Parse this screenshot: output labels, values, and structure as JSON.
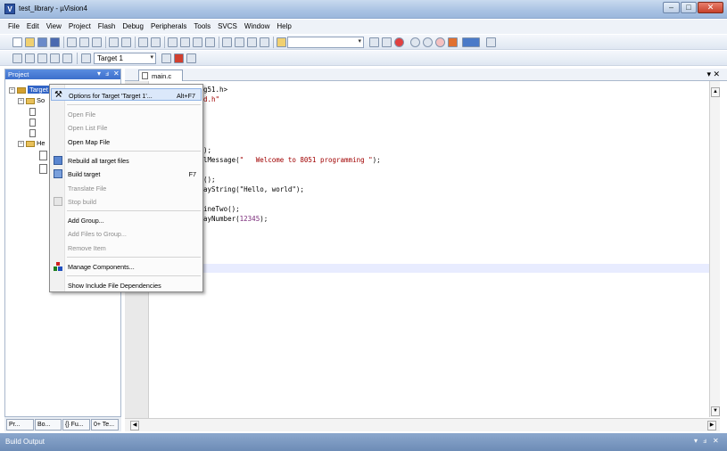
{
  "window": {
    "title": "test_library - µVision4",
    "app_icon": "V"
  },
  "menus": [
    "File",
    "Edit",
    "View",
    "Project",
    "Flash",
    "Debug",
    "Peripherals",
    "Tools",
    "SVCS",
    "Window",
    "Help"
  ],
  "toolbar2": {
    "target_select": "Target 1"
  },
  "project_pane": {
    "title": "Project",
    "tree": [
      {
        "label": "Target 1",
        "kind": "target",
        "selected": true
      },
      {
        "label": "So",
        "kind": "group"
      },
      {
        "label": "",
        "kind": "file"
      },
      {
        "label": "",
        "kind": "file"
      },
      {
        "label": "",
        "kind": "file"
      },
      {
        "label": "He",
        "kind": "group"
      },
      {
        "label": "",
        "kind": "file"
      },
      {
        "label": "",
        "kind": "file"
      }
    ],
    "bottom_tabs": [
      "Pr...",
      "Bo...",
      "{} Fu...",
      "0+ Te..."
    ]
  },
  "editor": {
    "tab": "main.c",
    "lines": [
      {
        "text": "g51.h>",
        "cls": ""
      },
      {
        "text": "d.h\"",
        "cls": "str"
      },
      {
        "text": ");",
        "cls": ""
      },
      {
        "text": "lMessage(\"   Welcome to 8051 programming \");",
        "cls": "mixed"
      },
      {
        "text": "();",
        "cls": ""
      },
      {
        "text": "ayString(\"Hello, world\");",
        "cls": ""
      },
      {
        "text": "ineTwo();",
        "cls": ""
      },
      {
        "text": "ayNumber(12345);",
        "cls": "numline"
      }
    ]
  },
  "context_menu": [
    {
      "label": "Options for Target 'Target 1'...",
      "shortcut": "Alt+F7",
      "enabled": true,
      "highlight": true,
      "icon": "wand-icon"
    },
    {
      "sep": true
    },
    {
      "label": "Open File",
      "enabled": false
    },
    {
      "label": "Open List File",
      "enabled": false
    },
    {
      "label": "Open Map File",
      "enabled": true
    },
    {
      "sep": true
    },
    {
      "label": "Rebuild all target files",
      "enabled": true,
      "icon": "rebuild-icon"
    },
    {
      "label": "Build target",
      "shortcut": "F7",
      "enabled": true,
      "icon": "build-icon"
    },
    {
      "label": "Translate File",
      "enabled": false
    },
    {
      "label": "Stop build",
      "enabled": false,
      "icon": "stop-build-icon"
    },
    {
      "sep": true
    },
    {
      "label": "Add Group...",
      "enabled": true
    },
    {
      "label": "Add Files to Group...",
      "enabled": false
    },
    {
      "label": "Remove Item",
      "enabled": false
    },
    {
      "sep": true
    },
    {
      "label": "Manage Components...",
      "enabled": true,
      "icon": "components-icon"
    },
    {
      "sep": true
    },
    {
      "label": "Show Include File Dependencies",
      "enabled": true
    }
  ],
  "build_output": {
    "title": "Build Output"
  },
  "colors": {
    "accent": "#3164c6",
    "menu_highlight": "#dbe8fa",
    "string": "#a00000",
    "number": "#7a2a7a"
  }
}
